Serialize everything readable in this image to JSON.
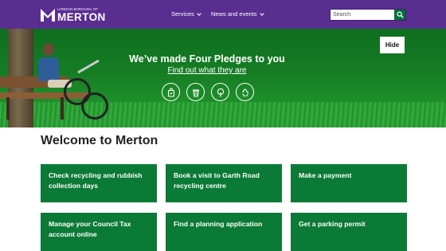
{
  "header": {
    "logo_small": "LONDON BOROUGH OF",
    "logo_big": "MERTON",
    "nav": [
      {
        "label": "Services"
      },
      {
        "label": "News and events"
      }
    ],
    "search": {
      "placeholder": "Search",
      "value": ""
    }
  },
  "banner": {
    "title": "We’ve made Four Pledges to you",
    "link": "Find out what they are",
    "hide_label": "Hide",
    "icons": [
      "shopping-bag-icon",
      "bin-icon",
      "tree-icon",
      "recycle-icon"
    ]
  },
  "main": {
    "title": "Welcome to Merton",
    "tiles": [
      {
        "label": "Check recycling and rubbish collection days"
      },
      {
        "label": "Book a visit to Garth Road recycling centre"
      },
      {
        "label": "Make a payment"
      },
      {
        "label": "Manage your Council Tax account online"
      },
      {
        "label": "Find a planning application"
      },
      {
        "label": "Get a parking permit"
      }
    ]
  },
  "colors": {
    "header_bg": "#5a2d91",
    "tile_bg": "#0b7a36",
    "search_button": "#00703c"
  }
}
